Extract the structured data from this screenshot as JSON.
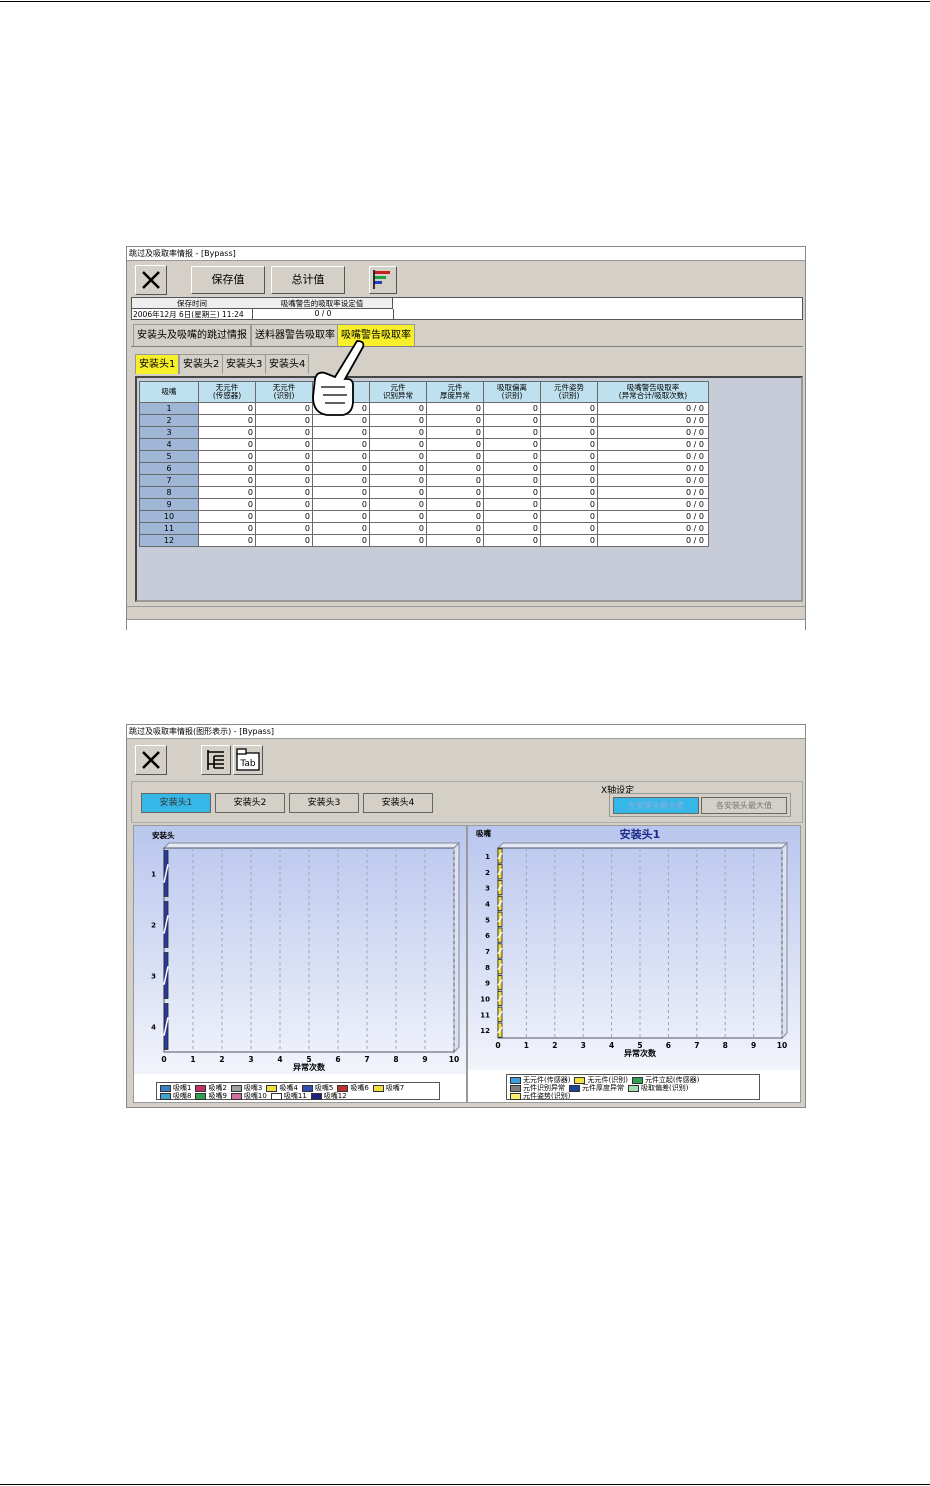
{
  "window1": {
    "title": "跳过及吸取率情报 - [Bypass]",
    "toolbar": {
      "close_icon": "close-x-icon",
      "save_label": "保存值",
      "total_label": "总计值",
      "chart_icon": "bar-chart-icon"
    },
    "info": {
      "save_time_header": "保存时间",
      "save_time_value": "2006年12月 6日(星期三) 11:24",
      "threshold_header": "吸嘴警告的吸取率设定值",
      "threshold_value": "0 / 0"
    },
    "main_tabs": [
      {
        "label": "安装头及吸嘴的跳过情报",
        "active": false
      },
      {
        "label": "送料器警告吸取率",
        "active": false
      },
      {
        "label": "吸嘴警告吸取率",
        "active": true
      }
    ],
    "head_tabs": [
      {
        "label": "安装头1",
        "active": true
      },
      {
        "label": "安装头2",
        "active": false
      },
      {
        "label": "安装头3",
        "active": false
      },
      {
        "label": "安装头4",
        "active": false
      }
    ],
    "table": {
      "headers": [
        [
          "吸嘴",
          ""
        ],
        [
          "无元件",
          "(传感器)"
        ],
        [
          "无元件",
          "(识别)"
        ],
        [
          "元件",
          "立起"
        ],
        [
          "元件",
          "识别异常"
        ],
        [
          "元件",
          "厚度异常"
        ],
        [
          "吸取偏离",
          "(识别)"
        ],
        [
          "元件姿势",
          "(识别)"
        ],
        [
          "吸嘴警告吸取率",
          "(异常合计/吸取次数)"
        ]
      ],
      "rows": [
        [
          "1",
          "0",
          "0",
          "0",
          "0",
          "0",
          "0",
          "0",
          "0 / 0"
        ],
        [
          "2",
          "0",
          "0",
          "0",
          "0",
          "0",
          "0",
          "0",
          "0 / 0"
        ],
        [
          "3",
          "0",
          "0",
          "0",
          "0",
          "0",
          "0",
          "0",
          "0 / 0"
        ],
        [
          "4",
          "0",
          "0",
          "0",
          "0",
          "0",
          "0",
          "0",
          "0 / 0"
        ],
        [
          "5",
          "0",
          "0",
          "0",
          "0",
          "0",
          "0",
          "0",
          "0 / 0"
        ],
        [
          "6",
          "0",
          "0",
          "0",
          "0",
          "0",
          "0",
          "0",
          "0 / 0"
        ],
        [
          "7",
          "0",
          "0",
          "0",
          "0",
          "0",
          "0",
          "0",
          "0 / 0"
        ],
        [
          "8",
          "0",
          "0",
          "0",
          "0",
          "0",
          "0",
          "0",
          "0 / 0"
        ],
        [
          "9",
          "0",
          "0",
          "0",
          "0",
          "0",
          "0",
          "0",
          "0 / 0"
        ],
        [
          "10",
          "0",
          "0",
          "0",
          "0",
          "0",
          "0",
          "0",
          "0 / 0"
        ],
        [
          "11",
          "0",
          "0",
          "0",
          "0",
          "0",
          "0",
          "0",
          "0 / 0"
        ],
        [
          "12",
          "0",
          "0",
          "0",
          "0",
          "0",
          "0",
          "0",
          "0 / 0"
        ]
      ]
    },
    "pointer_icon": "hand-pointer-icon"
  },
  "window2": {
    "title": "跳过及吸取率情报(图形表示) - [Bypass]",
    "toolbar": {
      "close_icon": "close-x-icon",
      "tree_icon": "tree-view-icon",
      "tab_icon": "tab-view-icon",
      "tab_icon_text": "Tab"
    },
    "head_buttons": [
      {
        "label": "安装头1",
        "active": true
      },
      {
        "label": "安装头2",
        "active": false
      },
      {
        "label": "安装头3",
        "active": false
      },
      {
        "label": "安装头4",
        "active": false
      }
    ],
    "xaxis_setting": {
      "label": "X轴设定",
      "btn_all": "全安装头最大值",
      "btn_each": "各安装头最大值"
    },
    "left_chart_legend": [
      "吸嘴1",
      "吸嘴2",
      "吸嘴3",
      "吸嘴4",
      "吸嘴5",
      "吸嘴6",
      "吸嘴7",
      "吸嘴8",
      "吸嘴9",
      "吸嘴10",
      "吸嘴11",
      "吸嘴12"
    ],
    "left_chart_legend_colors": [
      "#3b7fc4",
      "#c0306a",
      "#a0a0a0",
      "#f2e040",
      "#3050b0",
      "#c03030",
      "#f2e040",
      "#40a0d0",
      "#30a050",
      "#d070a0",
      "#ffffff",
      "#202080"
    ],
    "right_chart_legend": [
      "无元件(传感器)",
      "无元件(识别)",
      "元件立起(传感器)",
      "元件识别异常",
      "元件厚度异常",
      "吸取偏差(识别)",
      "元件姿势(识别)"
    ],
    "right_chart_legend_colors": [
      "#3b9fe0",
      "#f2e040",
      "#30a050",
      "#808080",
      "#2040a0",
      "#a0e0b0",
      "#f7ef70"
    ]
  },
  "chart_data": [
    {
      "type": "bar",
      "orientation": "horizontal",
      "title": "",
      "ylabel": "安装头",
      "xlabel": "异常次数",
      "categories": [
        "1",
        "2",
        "3",
        "4"
      ],
      "xlim": [
        0,
        10
      ],
      "xticks": [
        "0",
        "1",
        "2",
        "3",
        "4",
        "5",
        "6",
        "7",
        "8",
        "9",
        "10"
      ],
      "series_colors": [
        "#2a3aa0",
        "#ffffff"
      ],
      "series": [
        {
          "name": "吸嘴1",
          "values": [
            0,
            0,
            0,
            0
          ]
        },
        {
          "name": "吸嘴2",
          "values": [
            0,
            0,
            0,
            0
          ]
        },
        {
          "name": "吸嘴3",
          "values": [
            0,
            0,
            0,
            0
          ]
        },
        {
          "name": "吸嘴4",
          "values": [
            0,
            0,
            0,
            0
          ]
        },
        {
          "name": "吸嘴5",
          "values": [
            0,
            0,
            0,
            0
          ]
        },
        {
          "name": "吸嘴6",
          "values": [
            0,
            0,
            0,
            0
          ]
        },
        {
          "name": "吸嘴7",
          "values": [
            0,
            0,
            0,
            0
          ]
        },
        {
          "name": "吸嘴8",
          "values": [
            0,
            0,
            0,
            0
          ]
        },
        {
          "name": "吸嘴9",
          "values": [
            0,
            0,
            0,
            0
          ]
        },
        {
          "name": "吸嘴10",
          "values": [
            0,
            0,
            0,
            0
          ]
        },
        {
          "name": "吸嘴11",
          "values": [
            0,
            0,
            0,
            0
          ]
        },
        {
          "name": "吸嘴12",
          "values": [
            0,
            0,
            0,
            0
          ]
        }
      ],
      "grid": true
    },
    {
      "type": "bar",
      "orientation": "horizontal",
      "title": "安装头1",
      "ylabel": "吸嘴",
      "xlabel": "异常次数",
      "categories": [
        "1",
        "2",
        "3",
        "4",
        "5",
        "6",
        "7",
        "8",
        "9",
        "10",
        "11",
        "12"
      ],
      "xlim": [
        0,
        10
      ],
      "xticks": [
        "0",
        "1",
        "2",
        "3",
        "4",
        "5",
        "6",
        "7",
        "8",
        "9",
        "10"
      ],
      "series_colors": [
        "#f2e040",
        "#ffffff"
      ],
      "series": [
        {
          "name": "无元件(传感器)",
          "values": [
            0,
            0,
            0,
            0,
            0,
            0,
            0,
            0,
            0,
            0,
            0,
            0
          ]
        },
        {
          "name": "无元件(识别)",
          "values": [
            0,
            0,
            0,
            0,
            0,
            0,
            0,
            0,
            0,
            0,
            0,
            0
          ]
        },
        {
          "name": "元件立起(传感器)",
          "values": [
            0,
            0,
            0,
            0,
            0,
            0,
            0,
            0,
            0,
            0,
            0,
            0
          ]
        },
        {
          "name": "元件识别异常",
          "values": [
            0,
            0,
            0,
            0,
            0,
            0,
            0,
            0,
            0,
            0,
            0,
            0
          ]
        },
        {
          "name": "元件厚度异常",
          "values": [
            0,
            0,
            0,
            0,
            0,
            0,
            0,
            0,
            0,
            0,
            0,
            0
          ]
        },
        {
          "name": "吸取偏差(识别)",
          "values": [
            0,
            0,
            0,
            0,
            0,
            0,
            0,
            0,
            0,
            0,
            0,
            0
          ]
        },
        {
          "name": "元件姿势(识别)",
          "values": [
            0,
            0,
            0,
            0,
            0,
            0,
            0,
            0,
            0,
            0,
            0,
            0
          ]
        }
      ],
      "grid": true
    }
  ]
}
